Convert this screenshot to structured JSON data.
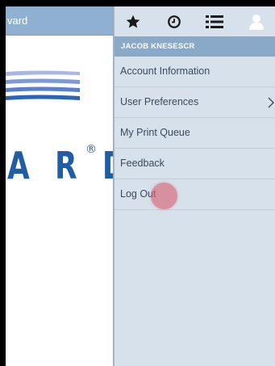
{
  "left_page": {
    "header_text": "vard",
    "logo_text": "A R D",
    "logo_registered_mark": "®",
    "colors": {
      "header": "#8fb0d0",
      "logo": "#1f5da5"
    }
  },
  "menu": {
    "toolbar": {
      "icons": [
        "star-icon",
        "clock-icon",
        "list-icon",
        "user-icon"
      ]
    },
    "user_name": "JACOB KNESESCR",
    "items": [
      {
        "label": "Account Information",
        "has_submenu": false
      },
      {
        "label": "User Preferences",
        "has_submenu": true
      },
      {
        "label": "My Print Queue",
        "has_submenu": false
      },
      {
        "label": "Feedback",
        "has_submenu": false
      },
      {
        "label": "Log Out",
        "has_submenu": false
      }
    ],
    "colors": {
      "panel": "#d7e1ec",
      "user_bar": "#8aa8c8",
      "item_text": "#3a4a5a",
      "divider": "#c2d0de"
    }
  },
  "tap_indicator": {
    "color": "#d6606e"
  }
}
